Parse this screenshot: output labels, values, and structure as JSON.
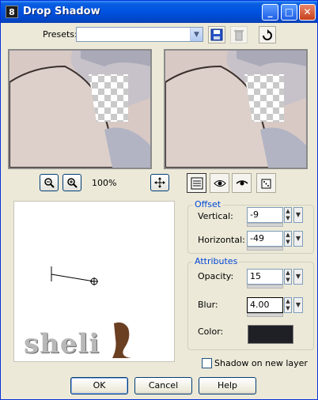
{
  "window": {
    "title": "Drop Shadow",
    "app_icon_glyph": "8"
  },
  "titlebar_buttons": {
    "minimize": "_",
    "maximize": "□",
    "close": "✕"
  },
  "presets": {
    "label": "Presets:",
    "value": ""
  },
  "zoom": {
    "level": "100%"
  },
  "offset": {
    "title": "Offset",
    "vertical_label": "Vertical:",
    "vertical_value": "-9",
    "horizontal_label": "Horizontal:",
    "horizontal_value": "-49"
  },
  "attributes": {
    "title": "Attributes",
    "opacity_label": "Opacity:",
    "opacity_value": "15",
    "blur_label": "Blur:",
    "blur_value": "4.00",
    "color_label": "Color:",
    "color_swatch": "#1f2026"
  },
  "shadow_on_new_layer": {
    "label": "Shadow on new layer",
    "checked": false
  },
  "buttons": {
    "ok": "OK",
    "cancel": "Cancel",
    "help": "Help"
  },
  "watermark": {
    "text": "sheli"
  },
  "colors": {
    "titlebar": "#0052e0",
    "accent": "#0046d5",
    "face": "#ece9d8"
  }
}
